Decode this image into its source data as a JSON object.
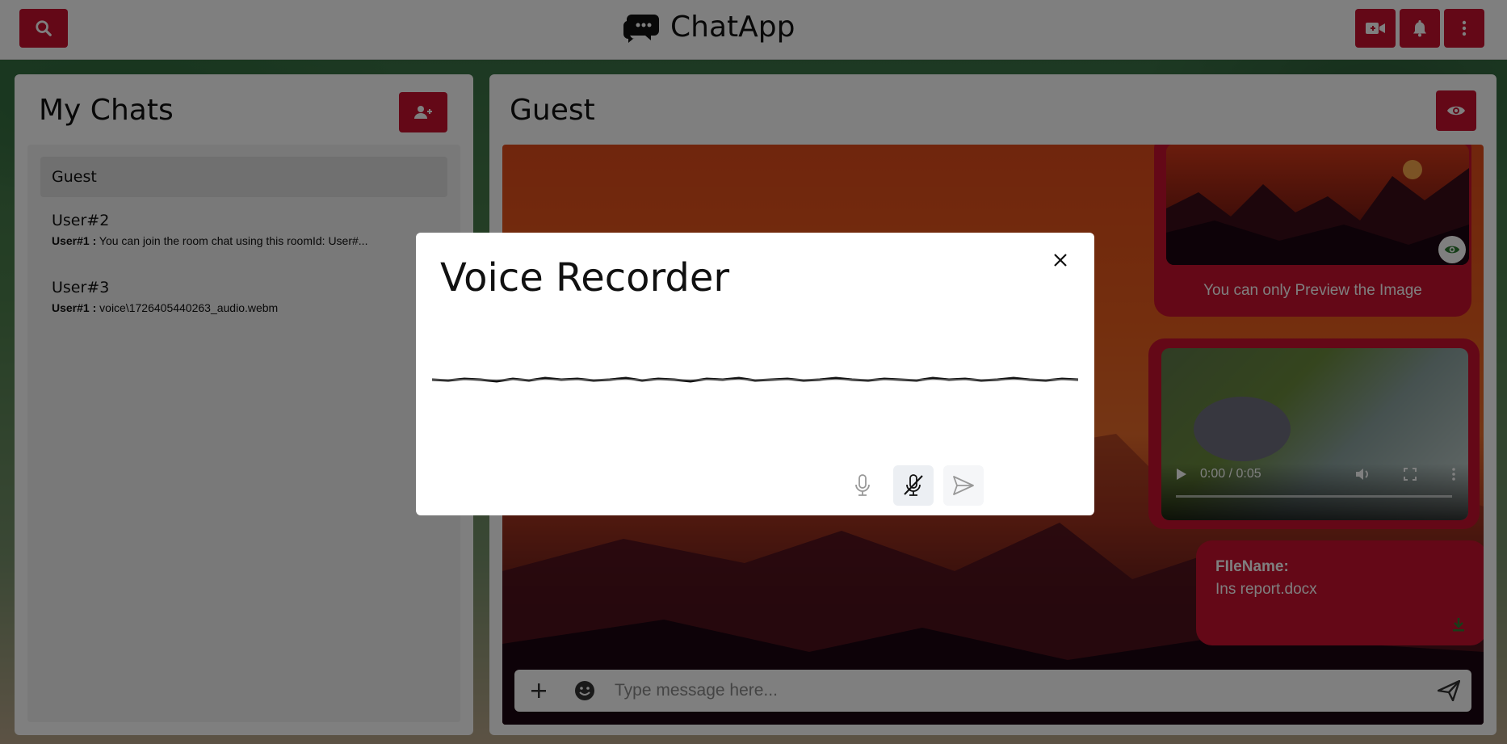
{
  "app": {
    "title": "ChatApp"
  },
  "colors": {
    "accent": "#c8102e",
    "success": "#2e7d32"
  },
  "icons": {
    "search": "search-icon",
    "video_call": "video-camera-icon",
    "notifications": "bell-icon",
    "menu": "kebab-menu-icon",
    "add_user": "add-user-icon",
    "view": "eye-icon"
  },
  "sidebar": {
    "title": "My Chats",
    "chats": [
      {
        "name": "Guest",
        "sender": "",
        "preview": ""
      },
      {
        "name": "User#2",
        "sender": "User#1 :",
        "preview": "You can join the room chat using this roomId: User#..."
      },
      {
        "name": "User#3",
        "sender": "User#1 :",
        "preview": "voice\\1726405440263_audio.webm"
      }
    ]
  },
  "chat": {
    "title": "Guest",
    "image_message": {
      "caption": "You can only Preview the Image"
    },
    "video_message": {
      "time": "0:00 / 0:05"
    },
    "file_message": {
      "label": "FIleName:",
      "filename": "Ins report.docx"
    },
    "input": {
      "placeholder": "Type message here..."
    }
  },
  "modal": {
    "title": "Voice Recorder",
    "buttons": [
      "microphone-icon",
      "microphone-off-icon",
      "send-icon"
    ]
  }
}
